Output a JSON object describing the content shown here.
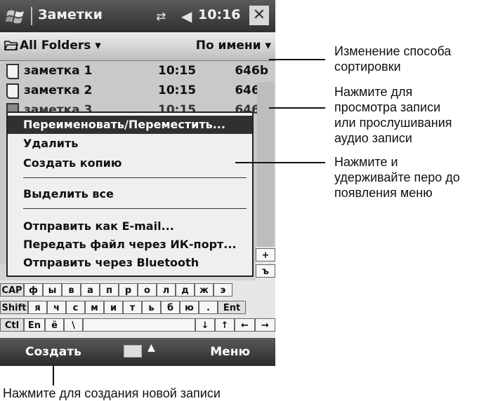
{
  "titlebar": {
    "app_title": "Заметки",
    "clock": "10:16",
    "icons": [
      "windows-logo-icon",
      "connectivity-icon",
      "volume-icon",
      "close-icon"
    ],
    "close_symbol": "✕",
    "conn_symbol": "⇄",
    "vol_symbol": "◀"
  },
  "folderbar": {
    "folder_label": "All Folders ▾",
    "sort_label": "По имени ▾"
  },
  "notes": [
    {
      "name": "заметка 1",
      "time": "10:15",
      "size": "646b"
    },
    {
      "name": "заметка 2",
      "time": "10:15",
      "size": "646b"
    },
    {
      "name": "заметка 3",
      "time": "10:15",
      "size": "646b"
    }
  ],
  "context_menu": {
    "items": [
      "Переименовать/Переместить...",
      "Удалить",
      "Создать копию",
      "Выделить все",
      "Отправить как E-mail...",
      "Передать файл через ИК-порт...",
      "Отправить через Bluetooth"
    ],
    "selected_index": 0
  },
  "keyboard": {
    "row1": [
      "CAP",
      "ф",
      "ы",
      "в",
      "а",
      "п",
      "р",
      "о",
      "л",
      "д",
      "ж",
      "э"
    ],
    "row2": [
      "Shift",
      "я",
      "ч",
      "с",
      "м",
      "и",
      "т",
      "ь",
      "б",
      "ю",
      ".",
      "Ent"
    ],
    "row3": [
      "Ctl",
      "En",
      "ё",
      "\\",
      "",
      "↓",
      "↑",
      "←",
      "→"
    ],
    "side_keys": [
      "+",
      "ъ"
    ]
  },
  "bottombar": {
    "left_softkey": "Создать",
    "right_softkey": "Меню",
    "sip_arrow": "▲"
  },
  "callouts": {
    "sort": "Изменение способа\nсортировки",
    "view": "Нажмите для\nпросмотра записи\nили прослушивания\nаудио записи",
    "hold": "Нажмите и\nудерживайте перо до\nпоявления меню",
    "create": "Нажмите для создания новой записи"
  }
}
